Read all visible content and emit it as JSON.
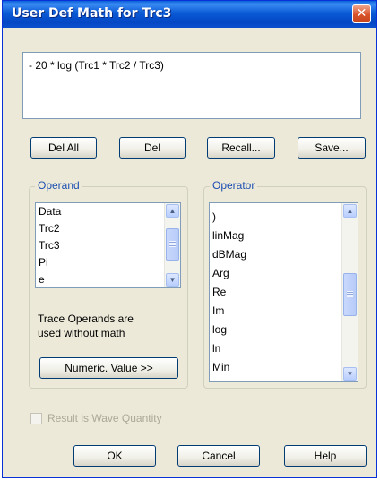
{
  "window": {
    "title": "User Def Math for Trc3",
    "close_glyph": "✕"
  },
  "expression": {
    "value": "- 20 * log (Trc1 * Trc2 / Trc3)"
  },
  "buttons": {
    "del_all": "Del All",
    "del": "Del",
    "recall": "Recall...",
    "save": "Save...",
    "numeric": "Numeric. Value >>",
    "ok": "OK",
    "cancel": "Cancel",
    "help": "Help"
  },
  "operand": {
    "title": "Operand",
    "items": [
      "Data",
      "Trc2",
      "Trc3",
      "Pi",
      "e"
    ],
    "note_line1": "Trace Operands are",
    "note_line2": "used without math"
  },
  "operator": {
    "title": "Operator",
    "items": [
      ")",
      "linMag",
      "dBMag",
      "Arg",
      "Re",
      "Im",
      "log",
      "ln",
      "Min"
    ]
  },
  "checkbox": {
    "label": "Result is Wave Quantity",
    "checked": false,
    "enabled": false
  },
  "icons": {
    "scroll_up": "▲",
    "scroll_down": "▼"
  }
}
